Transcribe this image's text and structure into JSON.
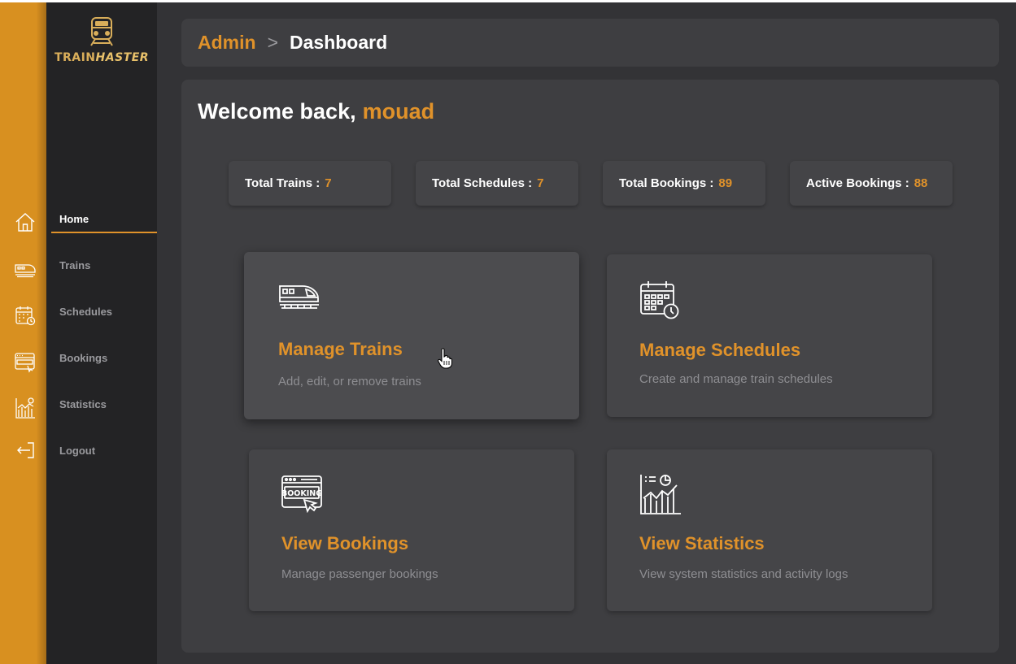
{
  "app": {
    "brand_part1": "TRAIN",
    "brand_part2": "HASTER",
    "accent_color": "#e0922a"
  },
  "breadcrumb": {
    "root": "Admin",
    "separator": ">",
    "current": "Dashboard"
  },
  "welcome": {
    "text": "Welcome back,",
    "username": "mouad"
  },
  "sidebar": {
    "items": [
      {
        "label": "Home",
        "icon": "home-icon",
        "active": true
      },
      {
        "label": "Trains",
        "icon": "train-icon",
        "active": false
      },
      {
        "label": "Schedules",
        "icon": "calendar-icon",
        "active": false
      },
      {
        "label": "Bookings",
        "icon": "booking-icon",
        "active": false
      },
      {
        "label": "Statistics",
        "icon": "statistics-icon",
        "active": false
      },
      {
        "label": "Logout",
        "icon": "logout-icon",
        "active": false
      }
    ]
  },
  "stats": [
    {
      "label": "Total Trains :",
      "value": "7"
    },
    {
      "label": "Total Schedules :",
      "value": "7"
    },
    {
      "label": "Total Bookings :",
      "value": "89"
    },
    {
      "label": "Active Bookings :",
      "value": "88"
    }
  ],
  "cards": [
    {
      "title": "Manage Trains",
      "description": "Add, edit, or remove trains",
      "icon": "train-icon"
    },
    {
      "title": "Manage Schedules",
      "description": "Create and manage train schedules",
      "icon": "calendar-icon"
    },
    {
      "title": "View Bookings",
      "description": "Manage passenger bookings",
      "icon": "booking-icon"
    },
    {
      "title": "View Statistics",
      "description": "View system statistics and activity logs",
      "icon": "statistics-icon"
    }
  ]
}
